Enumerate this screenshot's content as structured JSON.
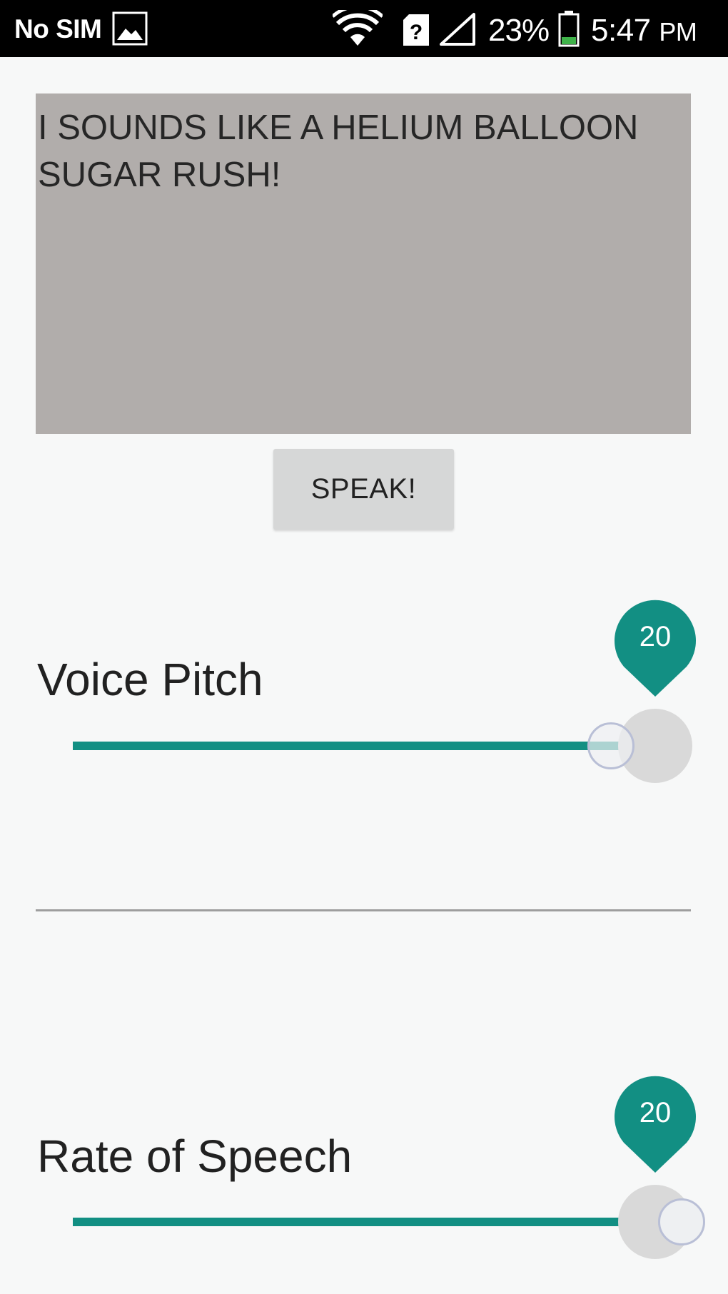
{
  "status_bar": {
    "carrier": "No SIM",
    "battery_percent": "23%",
    "time": "5:47",
    "ampm": "PM",
    "icons": [
      "gallery-icon",
      "wifi-icon",
      "sim-unknown-icon",
      "signal-icon",
      "battery-icon"
    ]
  },
  "text_input": {
    "value": "I SOUNDS LIKE A HELIUM BALLOON SUGAR RUSH!"
  },
  "speak_button": {
    "label": "SPEAK!"
  },
  "voice_pitch": {
    "label": "Voice Pitch",
    "value": "20",
    "position_fraction": 0.92
  },
  "rate_of_speech": {
    "label": "Rate of Speech",
    "value": "20",
    "position_fraction": 1.0
  },
  "colors": {
    "accent": "#128f83",
    "text_area_bg": "#b1adab",
    "status_bar_bg": "#000000"
  }
}
